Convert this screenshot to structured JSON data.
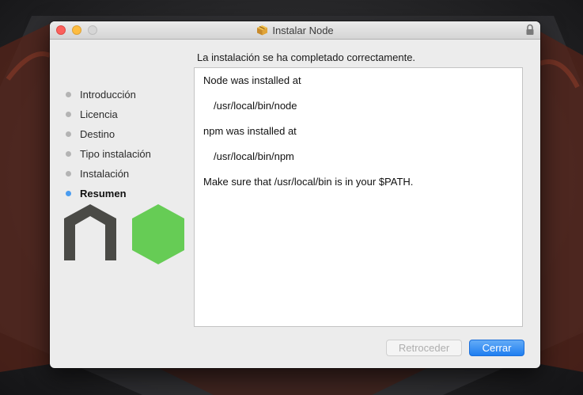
{
  "window": {
    "title": "Instalar Node"
  },
  "heading": "La instalación se ha completado correctamente.",
  "sidebar": {
    "steps": [
      {
        "label": "Introducción",
        "active": false
      },
      {
        "label": "Licencia",
        "active": false
      },
      {
        "label": "Destino",
        "active": false
      },
      {
        "label": "Tipo instalación",
        "active": false
      },
      {
        "label": "Instalación",
        "active": false
      },
      {
        "label": "Resumen",
        "active": true
      }
    ]
  },
  "content": {
    "line1": "Node was installed at",
    "path1": "/usr/local/bin/node",
    "line2": "npm was installed at",
    "path2": "/usr/local/bin/npm",
    "line3": "Make sure that /usr/local/bin is in your $PATH."
  },
  "buttons": {
    "back_label": "Retroceder",
    "close_label": "Cerrar"
  },
  "colors": {
    "accent_blue": "#1f7ef0",
    "node_green": "#66cc55",
    "node_dark": "#4a4a46",
    "active_dot": "#4a9cf0"
  }
}
